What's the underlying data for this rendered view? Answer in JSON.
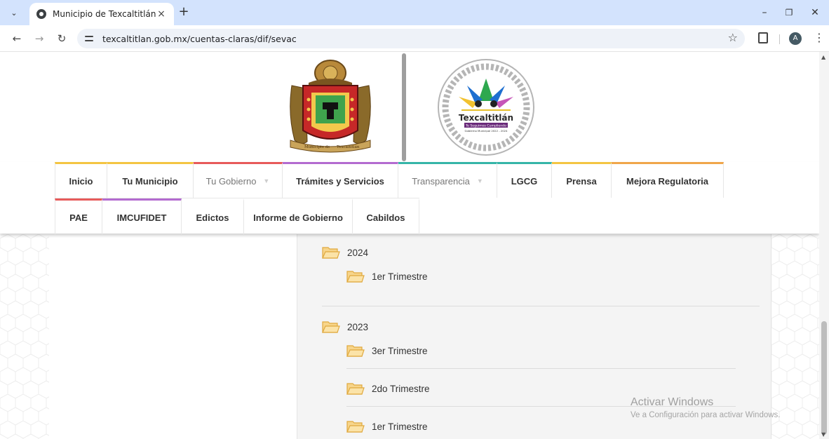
{
  "browser": {
    "tab_title": "Municipio de Texcaltitlán",
    "close_glyph": "×",
    "new_tab_glyph": "+",
    "url": "texcaltitlan.gob.mx/cuentas-claras/dif/sevac",
    "profile_initial": "A",
    "window_controls": {
      "minimize": "–",
      "restore": "❐",
      "close": "✕"
    }
  },
  "logos": {
    "crest_text_left": "Municipio de",
    "crest_text_right": "Texcaltitlán",
    "admin_name": "Texcaltitlán",
    "admin_slogan": "Te Seguimos Cumpliendo",
    "admin_period": "Gobierno Municipal 2022 - 2024"
  },
  "nav": {
    "row1": [
      {
        "label": "Inicio",
        "accent": "#f4c542"
      },
      {
        "label": "Tu Municipio",
        "accent": "#f4c542"
      },
      {
        "label": "Tu Gobierno",
        "accent": "#e75a5a",
        "dropdown": true
      },
      {
        "label": "Trámites y Servicios",
        "accent": "#b36bd0"
      },
      {
        "label": "Transparencia",
        "accent": "#35b5a8",
        "dropdown": true
      },
      {
        "label": "LGCG",
        "accent": "#35b5a8"
      },
      {
        "label": "Prensa",
        "accent": "#f4c542"
      },
      {
        "label": "Mejora Regulatoria",
        "accent": "#f0a64a"
      }
    ],
    "row2": [
      {
        "label": "PAE",
        "accent": "#e75a5a"
      },
      {
        "label": "IMCUFIDET",
        "accent": "#b36bd0"
      },
      {
        "label": "Edictos"
      },
      {
        "label": "Informe de Gobierno"
      },
      {
        "label": "Cabildos"
      }
    ]
  },
  "folders": [
    {
      "year": "2024",
      "items": [
        "1er Trimestre"
      ]
    },
    {
      "year": "2023",
      "items": [
        "3er Trimestre",
        "2do Trimestre",
        "1er Trimestre"
      ]
    }
  ],
  "colors": {
    "folder_fill": "#f7d58b",
    "folder_stroke": "#e0a93e",
    "tab_strip": "#d3e3fd"
  },
  "watermark": {
    "title": "Activar Windows",
    "subtitle": "Ve a Configuración para activar Windows."
  }
}
